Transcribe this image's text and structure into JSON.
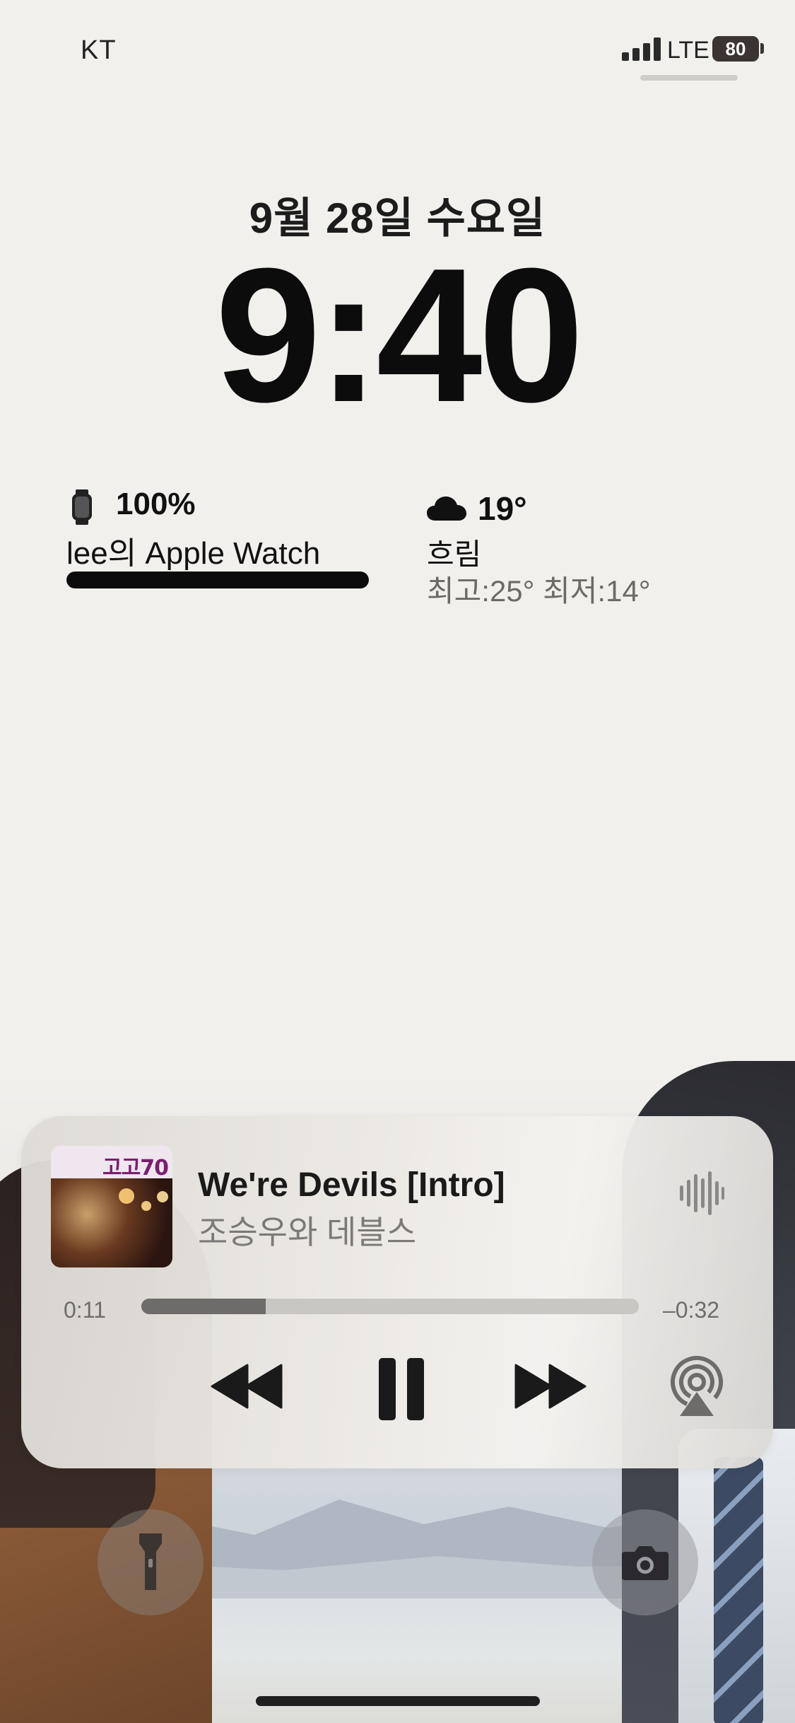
{
  "status_bar": {
    "carrier": "KT",
    "network": "LTE",
    "battery": "80",
    "icons": [
      "signal-icon",
      "battery-icon"
    ]
  },
  "lock_screen": {
    "date": "9월 28일 수요일",
    "time": "9:40"
  },
  "widgets": {
    "watch": {
      "icon": "apple-watch-icon",
      "battery_pct": "100%",
      "battery_level": 1.0,
      "name": "lee의 Apple Watch"
    },
    "weather": {
      "icon": "cloud-icon",
      "temp": "19°",
      "condition": "흐림",
      "hilo": "최고:25° 최저:14°"
    }
  },
  "now_playing": {
    "album_art_text": "고고70",
    "title": "We're Devils [Intro]",
    "artist": "조승우와 데블스",
    "elapsed": "0:11",
    "remaining": "–0:32",
    "progress": 0.25,
    "icons": [
      "waveform-icon",
      "rewind-icon",
      "pause-icon",
      "fast-forward-icon",
      "airplay-icon"
    ]
  },
  "bottom_controls": {
    "icons": [
      "flashlight-icon",
      "camera-icon"
    ]
  },
  "colors": {
    "background": "#f1f0ed",
    "text_primary": "#111111",
    "text_secondary": "#6b6a67"
  }
}
